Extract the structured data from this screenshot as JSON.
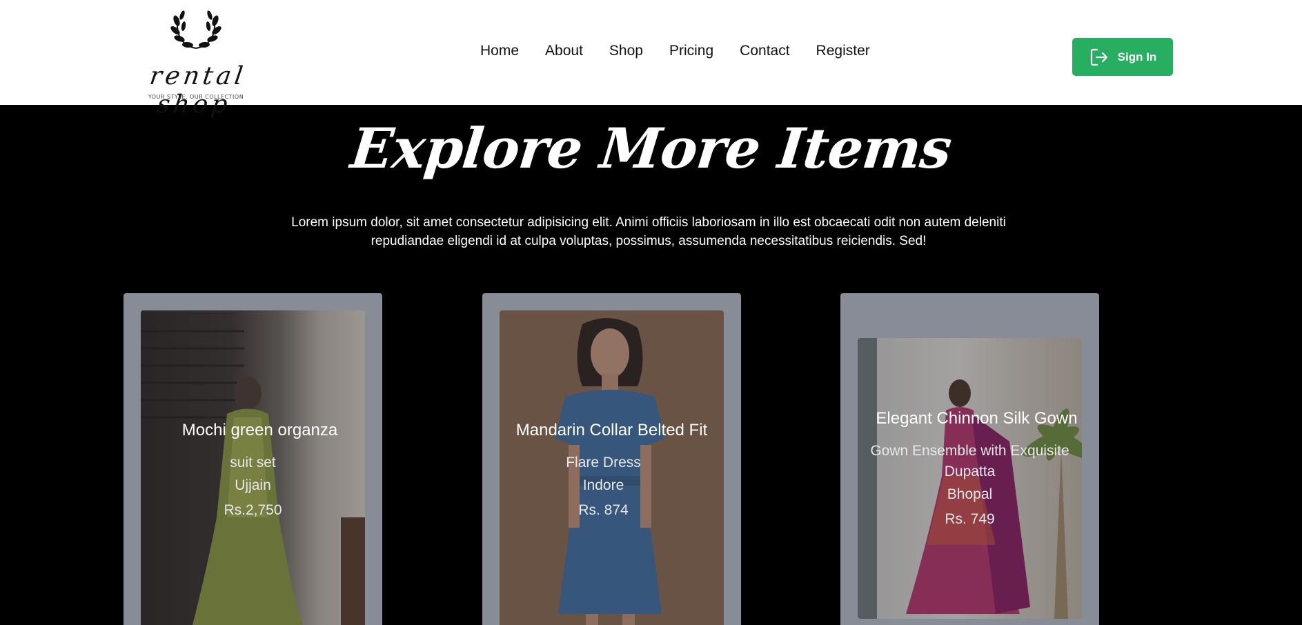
{
  "logo": {
    "name": "rental shop",
    "tagline": "YOUR STYLE, OUR COLLECTION"
  },
  "nav": {
    "items": [
      "Home",
      "About",
      "Shop",
      "Pricing",
      "Contact",
      "Register"
    ]
  },
  "signin": {
    "label": "Sign In",
    "icon": "sign-in-icon"
  },
  "hero": {
    "title": "Explore More Items",
    "description": "Lorem ipsum dolor, sit amet consectetur adipisicing elit. Animi officiis laboriosam in illo est obcaecati odit non autem deleniti repudiandae eligendi id at culpa voluptas, possimus, assumenda necessitatibus reiciendis. Sed!"
  },
  "products": [
    {
      "name": "Mochi green organza",
      "subtitle": "suit set",
      "location": "Ujjain",
      "price": "Rs.2,750"
    },
    {
      "name": "Mandarin Collar Belted Fit",
      "subtitle": "Flare Dress",
      "location": "Indore",
      "price": "Rs. 874"
    },
    {
      "name": "Elegant Chinnon Silk Gown",
      "subtitle": "Gown Ensemble with Exquisite Dupatta",
      "location": "Bhopal",
      "price": "Rs. 749"
    }
  ],
  "colors": {
    "header_bg": "#ffffff",
    "page_bg": "#000000",
    "accent": "#27ae60",
    "card_bg": "#878c96"
  }
}
